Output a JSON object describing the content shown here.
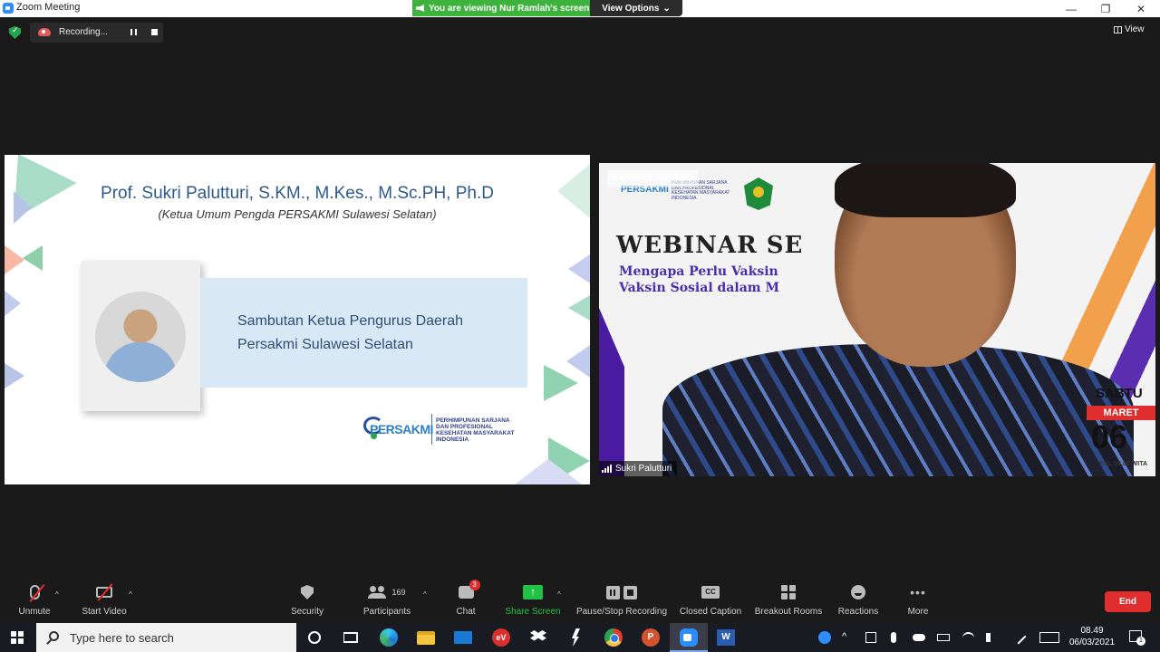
{
  "window": {
    "title": "Zoom Meeting",
    "viewing_banner": "You are viewing Nur Ramlah's screen",
    "view_options": "View Options",
    "view_options_caret": "⌄",
    "minimize": "—",
    "maximize": "❐",
    "close": "✕"
  },
  "recording": {
    "label": "Recording..."
  },
  "view_toggle": {
    "label": "View"
  },
  "shared_screen": {
    "presenter": "Prof. Sukri Palutturi, S.KM., M.Kes., M.Sc.PH, Ph.D",
    "role": "(Ketua Umum Pengda PERSAKMI Sulawesi Selatan)",
    "banner_line1": "Sambutan Ketua Pengurus Daerah",
    "banner_line2": "Persakmi Sulawesi Selatan",
    "logo_word": "PERSAKMI",
    "logo_org_1": "PERHIMPUNAN SARJANA",
    "logo_org_2": "DAN PROFESIONAL",
    "logo_org_3": "KESEHATAN MASYARAKAT",
    "logo_org_4": "INDONESIA"
  },
  "video": {
    "spotlight_label": "Remove Spotlight",
    "participant_name": "Sukri Palutturi",
    "bg_logo_word": "PERSAKMI",
    "bg_logo_org": "PERHIMPUNAN SARJANA DAN PROFESIONAL KESEHATAN MASYARAKAT INDONESIA",
    "bg_title": "WEBINAR SE",
    "bg_sub1": "Mengapa Perlu Vaksin",
    "bg_sub2": "Vaksin Sosial dalam M",
    "bg_day_name": "SABTU",
    "bg_month": "MARET",
    "bg_day": "06",
    "bg_time": "KUL 08.00 WITA"
  },
  "toolbar": {
    "unmute": "Unmute",
    "start_video": "Start Video",
    "security": "Security",
    "participants": "Participants",
    "participants_count": "169",
    "chat": "Chat",
    "chat_badge": "3",
    "share_screen": "Share Screen",
    "share_arrow": "↑",
    "pause_stop": "Pause/Stop Recording",
    "closed_caption": "Closed Caption",
    "cc_glyph": "CC",
    "breakout": "Breakout Rooms",
    "reactions": "Reactions",
    "more": "More",
    "more_glyph": "•••",
    "caret": "^",
    "end": "End",
    "share_color": "#23c146",
    "end_color": "#e02d2d"
  },
  "taskbar": {
    "search_placeholder": "Type here to search",
    "ev_label": "eV",
    "ppt_label": "P",
    "word_label": "W",
    "tray_chevron": "^",
    "time": "08.49",
    "date": "06/03/2021",
    "notification_count": "1"
  }
}
